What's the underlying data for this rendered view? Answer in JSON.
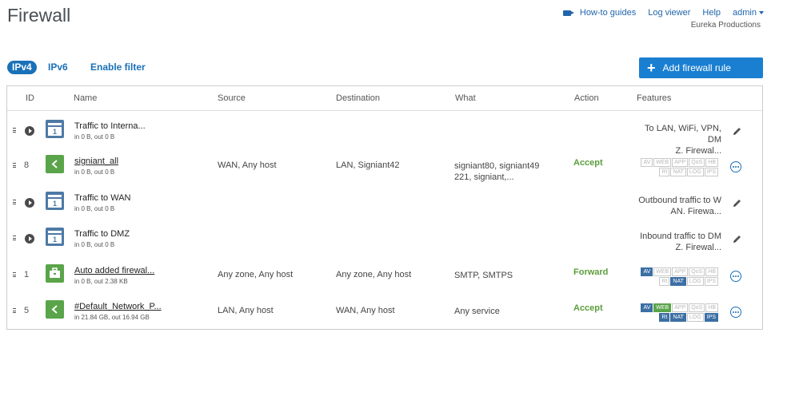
{
  "page": {
    "title": "Firewall"
  },
  "topnav": {
    "howto": "How-to guides",
    "log_viewer": "Log viewer",
    "help": "Help",
    "user": "admin",
    "company": "Eureka Productions"
  },
  "filters": {
    "ipv4": "IPv4",
    "ipv6": "IPv6",
    "enable_filter": "Enable filter"
  },
  "add_button": "Add firewall rule",
  "headers": {
    "id": "ID",
    "name": "Name",
    "source": "Source",
    "destination": "Destination",
    "what": "What",
    "action": "Action",
    "features": "Features"
  },
  "rows": [
    {
      "name": "Traffic to Interna...",
      "traffic": "in 0 B, out 0 B",
      "features_text": [
        "To LAN, WiFi, VPN, DM",
        "Z. Firewal..."
      ]
    },
    {
      "id": "8",
      "name": "signiant_all",
      "traffic": "in 0 B, out 0 B",
      "source": "WAN, Any host",
      "destination": "LAN, Signiant42",
      "what": "signiant80, signiant49 221, signiant,...",
      "action": "Accept"
    },
    {
      "name": "Traffic to WAN",
      "traffic": "in 0 B, out 0 B",
      "features_text": [
        "Outbound traffic to W",
        "AN. Firewa..."
      ]
    },
    {
      "name": "Traffic to DMZ",
      "traffic": "in 0 B, out 0 B",
      "features_text": [
        "Inbound traffic to DM",
        "Z. Firewal..."
      ]
    },
    {
      "id": "1",
      "name": "Auto added firewal...",
      "traffic": "in 0 B, out 2.38 KB",
      "source": "Any zone, Any host",
      "destination": "Any zone, Any host",
      "what": "SMTP, SMTPS",
      "action": "Forward"
    },
    {
      "id": "5",
      "name": "#Default_Network_P...",
      "traffic": "in 21.84 GB, out 16.94 GB",
      "source": "LAN, Any host",
      "destination": "WAN, Any host",
      "what": "Any service",
      "action": "Accept"
    }
  ],
  "badge_labels": {
    "av": "AV",
    "web": "WEB",
    "app": "APP",
    "qos": "QoS",
    "hb": "HB",
    "rt": "Rt",
    "nat": "NAT",
    "log": "LOG",
    "ips": "IPS"
  },
  "colors": {
    "accent": "#1a71b8",
    "button": "#1a7fd1",
    "accept": "#5a9e3c",
    "group_icon": "#4d7aa5",
    "rule_icon": "#5aa44a"
  }
}
